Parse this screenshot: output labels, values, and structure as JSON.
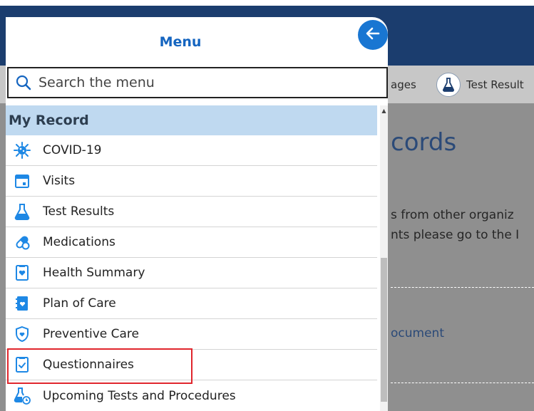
{
  "background": {
    "shortcut_left_label": "ages",
    "shortcut_right_label": "Test Result",
    "page_title": "cords",
    "text_line_1": "s from other organiz",
    "text_line_2": "nts please go to the I",
    "link_text": "ocument"
  },
  "menu": {
    "title": "Menu",
    "search": {
      "placeholder": "Search the menu"
    },
    "section": "My Record",
    "items": [
      {
        "label": "COVID-19",
        "icon": "covid-icon"
      },
      {
        "label": "Visits",
        "icon": "calendar-icon"
      },
      {
        "label": "Test Results",
        "icon": "flask-icon"
      },
      {
        "label": "Medications",
        "icon": "pill-icon"
      },
      {
        "label": "Health Summary",
        "icon": "health-summary-icon"
      },
      {
        "label": "Plan of Care",
        "icon": "plan-of-care-icon"
      },
      {
        "label": "Preventive Care",
        "icon": "shield-heart-icon"
      },
      {
        "label": "Questionnaires",
        "icon": "clipboard-check-icon"
      },
      {
        "label": "Upcoming Tests and Procedures",
        "icon": "flask-clock-icon"
      }
    ],
    "highlighted_item": "Questionnaires"
  },
  "colors": {
    "accent": "#1976d2",
    "header_bg": "#1b3d6e",
    "section_bg": "#bfd9f0",
    "highlight_border": "#e0262d"
  }
}
